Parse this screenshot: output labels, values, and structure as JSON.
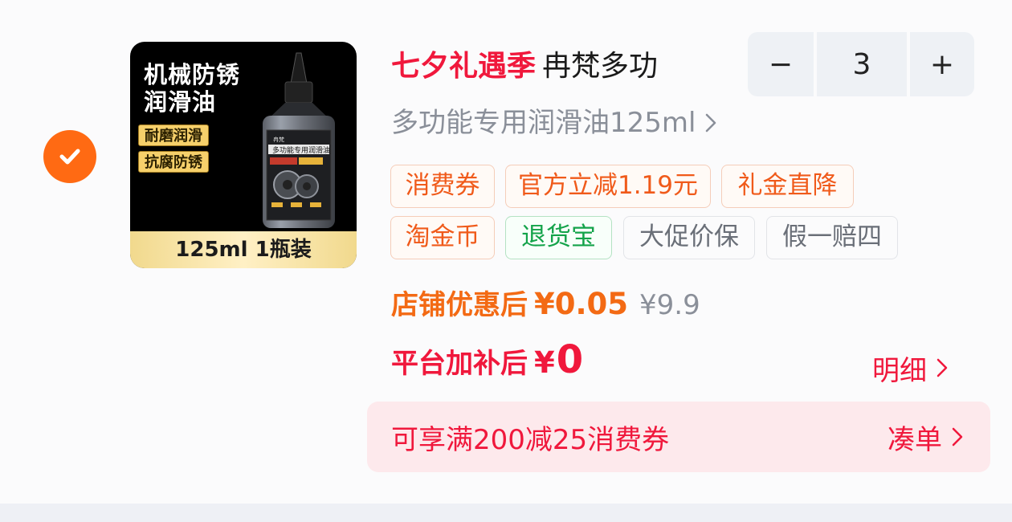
{
  "product": {
    "image": {
      "title_line1": "机械防锈",
      "title_line2": "润滑油",
      "tag1": "耐磨润滑",
      "tag2": "抗腐防锈",
      "bottom_label": "125ml  1瓶装",
      "bottle_brand": "冉梵",
      "bottle_label": "多功能专用润滑油"
    },
    "promo_label": "七夕礼遇季",
    "title": "冉梵多功",
    "sku": "多功能专用润滑油125ml",
    "quantity": {
      "minus": "−",
      "value": "3",
      "plus": "+"
    },
    "tags": [
      {
        "label": "消费券"
      },
      {
        "label": "官方立减1.19元"
      },
      {
        "label": "礼金直降"
      },
      {
        "label": "淘金币"
      },
      {
        "label": "退货宝"
      },
      {
        "label": "大促价保"
      },
      {
        "label": "假一赔四"
      }
    ],
    "store_price": {
      "label": "店铺优惠后",
      "value": "¥0.05",
      "original": "¥9.9"
    },
    "platform_price": {
      "label": "平台加补后",
      "currency": "¥",
      "value": "0"
    },
    "detail_link": "明细",
    "coupon": {
      "text": "可享满200减25消费券",
      "action": "凑单"
    }
  },
  "colors": {
    "accent_red": "#f0183c",
    "accent_orange": "#f36a14",
    "check_orange": "#ff6a13",
    "tag_green": "#14a34a"
  },
  "icons": {
    "check": "checkmark-icon",
    "sku_arrow": "chevron-right-icon",
    "detail_arrow": "chevron-right-icon",
    "coupon_arrow": "chevron-right-icon"
  }
}
